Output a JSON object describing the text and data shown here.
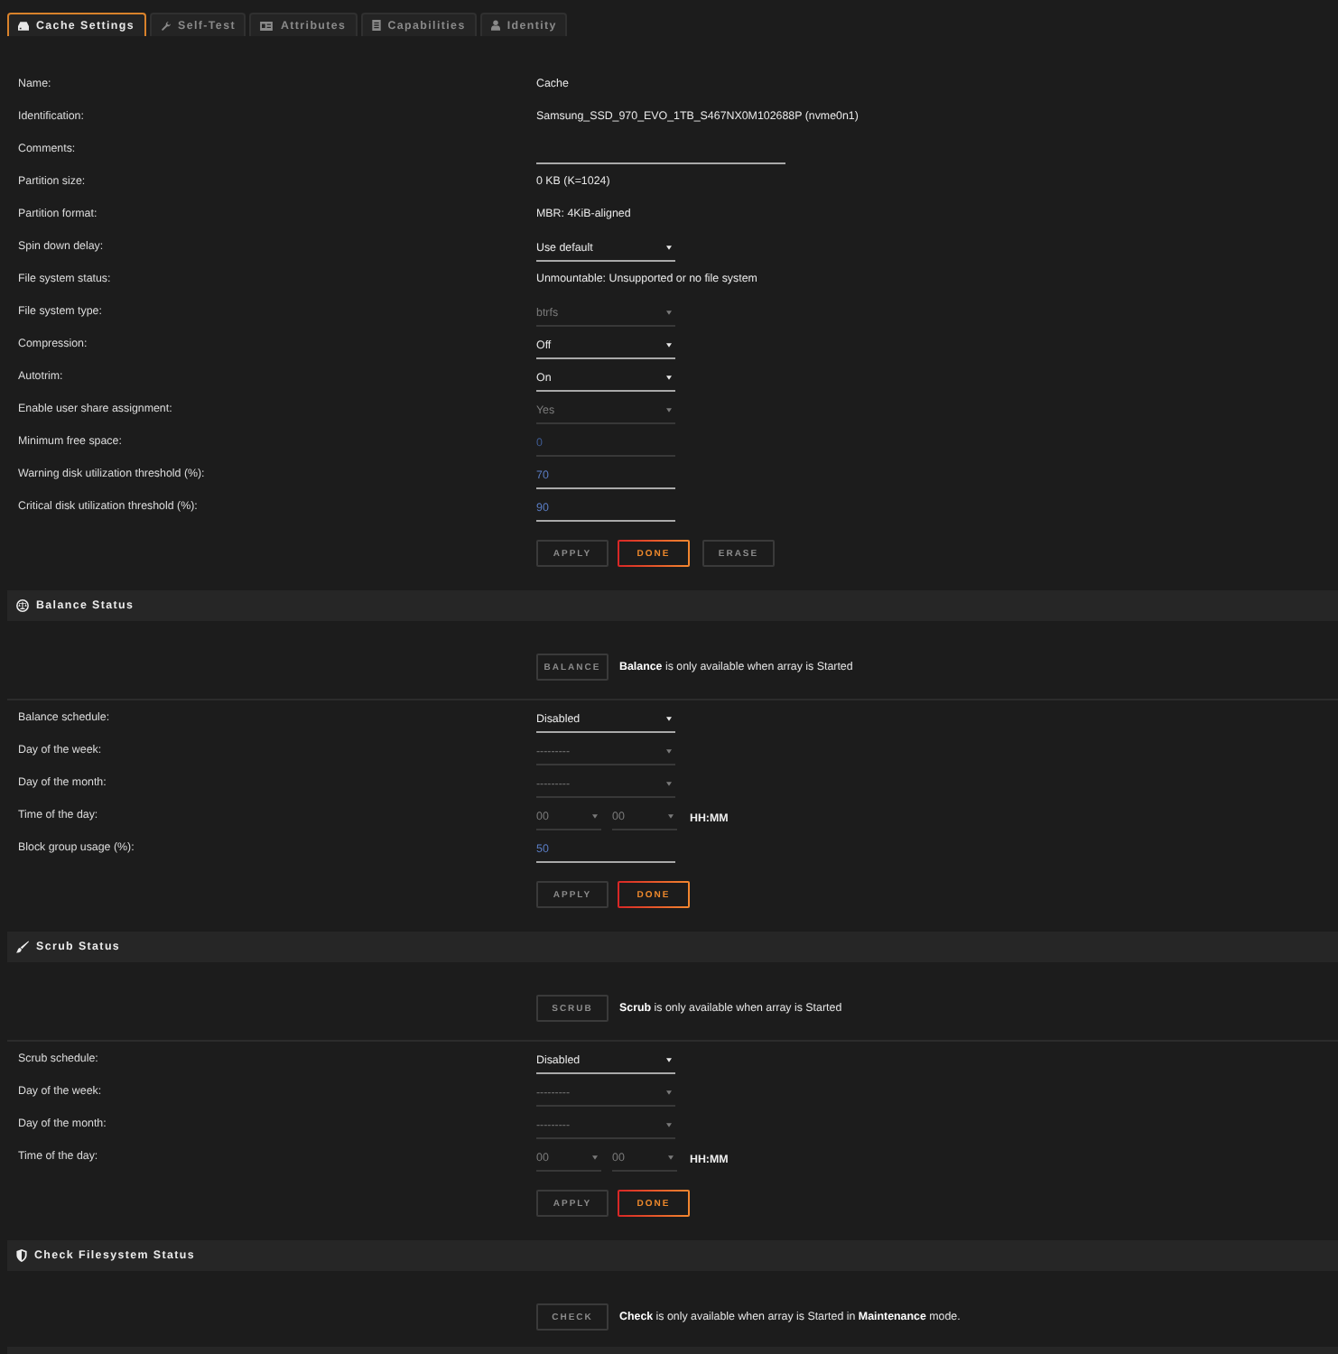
{
  "tabs": [
    {
      "label": "Cache Settings",
      "selected": true
    },
    {
      "label": "Self-Test",
      "selected": false
    },
    {
      "label": "Attributes",
      "selected": false
    },
    {
      "label": "Capabilities",
      "selected": false
    },
    {
      "label": "Identity",
      "selected": false
    }
  ],
  "settings": {
    "rows": [
      {
        "label": "Name:",
        "kind": "text",
        "value": "Cache"
      },
      {
        "label": "Identification:",
        "kind": "text",
        "value": "Samsung_SSD_970_EVO_1TB_S467NX0M102688P (nvme0n1)"
      },
      {
        "label": "Comments:",
        "kind": "long_input",
        "disabled": false
      },
      {
        "label": "Partition size:",
        "kind": "text",
        "value": "0 KB (K=1024)"
      },
      {
        "label": "Partition format:",
        "kind": "text",
        "value": "MBR: 4KiB-aligned"
      },
      {
        "label": "Spin down delay:",
        "kind": "select",
        "value": "Use default",
        "disabled": false
      },
      {
        "label": "File system status:",
        "kind": "text",
        "value": "Unmountable: Unsupported or no file system"
      },
      {
        "label": "File system type:",
        "kind": "select",
        "value": "btrfs",
        "disabled": true
      },
      {
        "label": "Compression:",
        "kind": "select",
        "value": "Off",
        "disabled": false
      },
      {
        "label": "Autotrim:",
        "kind": "select",
        "value": "On",
        "disabled": false
      },
      {
        "label": "Enable user share assignment:",
        "kind": "select",
        "value": "Yes",
        "disabled": true
      },
      {
        "label": "Minimum free space:",
        "kind": "input",
        "value": "0",
        "disabled": true
      },
      {
        "label": "Warning disk utilization threshold (%):",
        "kind": "input",
        "value": "70",
        "disabled": false
      },
      {
        "label": "Critical disk utilization threshold (%):",
        "kind": "input",
        "value": "90",
        "disabled": false
      }
    ],
    "buttons": [
      {
        "label": "APPLY",
        "disabled": true
      },
      {
        "label": "DONE",
        "disabled": false
      },
      {
        "label": "ERASE",
        "disabled": true
      }
    ]
  },
  "sections": [
    {
      "title": "Balance Status",
      "action": {
        "label": "BALANCE",
        "disabled": true
      },
      "message": "**Balance** is only available when array is Started",
      "rows": [
        {
          "label": "Balance schedule:",
          "kind": "select",
          "value": "Disabled",
          "disabled": false
        },
        {
          "label": "Day of the week:",
          "kind": "select",
          "value": "---------",
          "disabled": true
        },
        {
          "label": "Day of the month:",
          "kind": "select",
          "value": "---------",
          "disabled": true
        },
        {
          "label": "Time of the day:",
          "kind": "time",
          "hour": {
            "value": "00",
            "disabled": true
          },
          "minute": {
            "value": "00",
            "disabled": true
          },
          "format": "HH:MM"
        },
        {
          "label": "Block group usage (%):",
          "kind": "input",
          "value": "50",
          "disabled": false
        }
      ],
      "buttons": [
        {
          "label": "APPLY",
          "disabled": true
        },
        {
          "label": "DONE",
          "disabled": false
        }
      ]
    },
    {
      "title": "Scrub Status",
      "action": {
        "label": "SCRUB",
        "disabled": true
      },
      "message": "**Scrub** is only available when array is Started",
      "rows": [
        {
          "label": "Scrub schedule:",
          "kind": "select",
          "value": "Disabled",
          "disabled": false
        },
        {
          "label": "Day of the week:",
          "kind": "select",
          "value": "---------",
          "disabled": true
        },
        {
          "label": "Day of the month:",
          "kind": "select",
          "value": "---------",
          "disabled": true
        },
        {
          "label": "Time of the day:",
          "kind": "time",
          "hour": {
            "value": "00",
            "disabled": true
          },
          "minute": {
            "value": "00",
            "disabled": true
          },
          "format": "HH:MM"
        }
      ],
      "buttons": [
        {
          "label": "APPLY",
          "disabled": true
        },
        {
          "label": "DONE",
          "disabled": false
        }
      ]
    },
    {
      "title": "Check Filesystem Status",
      "action": {
        "label": "CHECK",
        "disabled": true
      },
      "message": "**Check** is only available when array is Started in **Maintenance** mode."
    }
  ]
}
